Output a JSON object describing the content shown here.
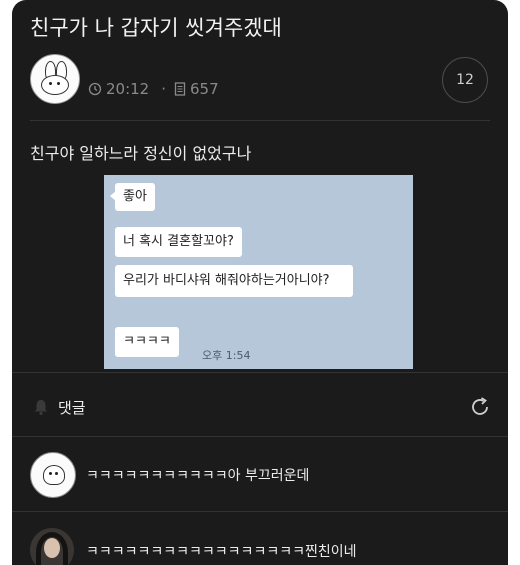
{
  "post": {
    "title": "친구가 나 갑자기 씻겨주겠대",
    "time": "20:12",
    "views": "657",
    "separator": "·",
    "comment_count": "12",
    "body": "친구야 일하느라 정신이 없었구나"
  },
  "chat_image": {
    "messages": [
      "좋아",
      "너 혹시 결혼할꼬야?",
      "우리가 바디샤워 해줘야하는거아니야?",
      "ㅋㅋㅋㅋ"
    ],
    "timestamp": "오후 1:54",
    "background_color": "#b6c7d9"
  },
  "comments_section": {
    "label": "댓글",
    "items": [
      {
        "text": "ㅋㅋㅋㅋㅋㅋㅋㅋㅋㅋㅋ아 부끄러운데"
      },
      {
        "text": "ㅋㅋㅋㅋㅋㅋㅋㅋㅋㅋㅋㅋㅋㅋㅋㅋㅋ찐친이네"
      }
    ]
  },
  "colors": {
    "background": "#1b1b1b",
    "text": "#ececec",
    "muted": "#8a8a8a"
  }
}
